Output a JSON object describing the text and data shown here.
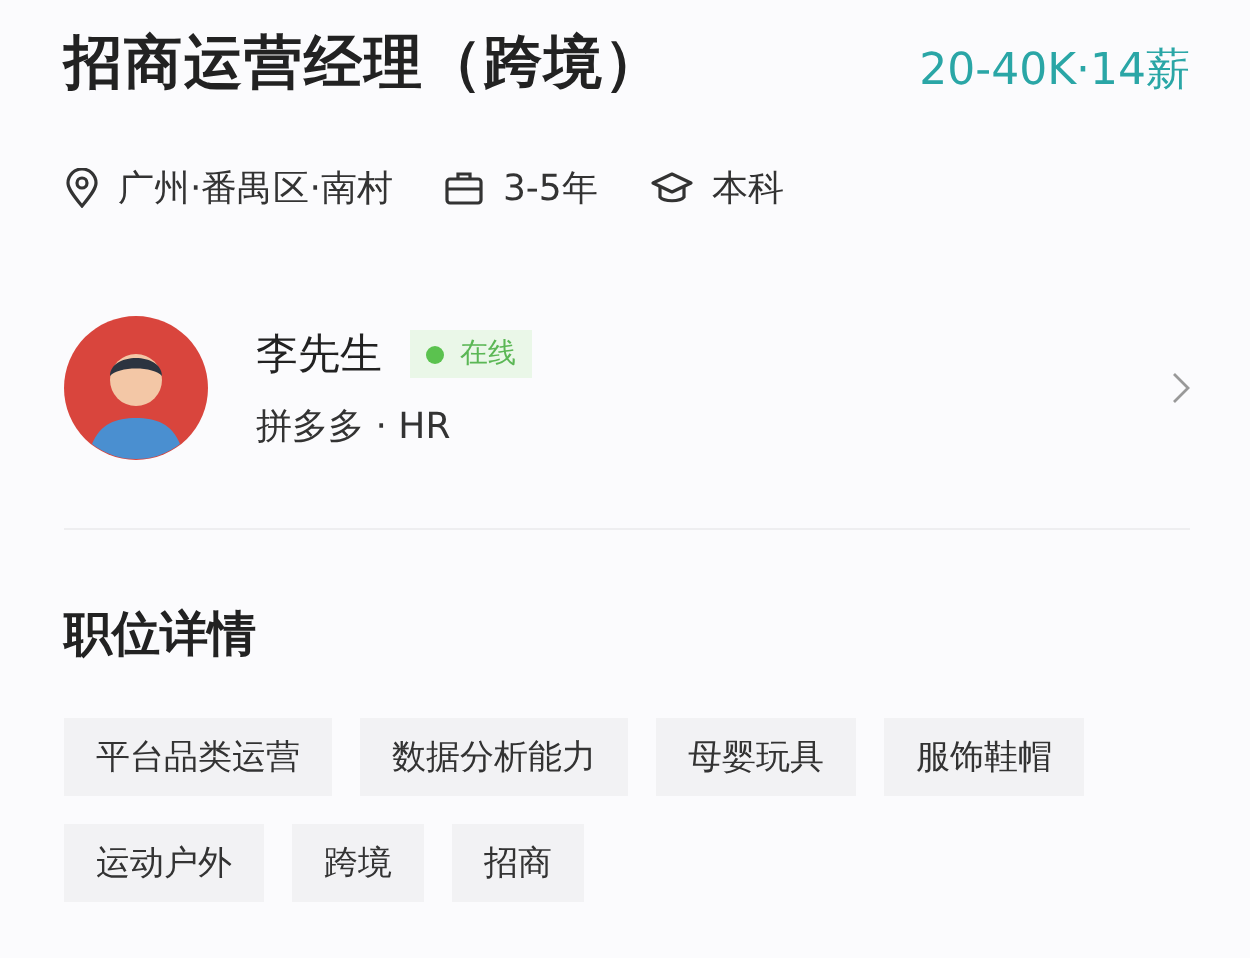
{
  "job": {
    "title": "招商运营经理（跨境）",
    "salary": "20-40K·14薪"
  },
  "meta": [
    {
      "kind": "location",
      "text": "广州·番禺区·南村"
    },
    {
      "kind": "experience",
      "text": "3-5年"
    },
    {
      "kind": "education",
      "text": "本科"
    }
  ],
  "recruiter": {
    "name": "李先生",
    "online": true,
    "status": "在线",
    "company": "拼多多 · HR"
  },
  "details": {
    "heading": "职位详情",
    "tags": [
      "平台品类运营",
      "数据分析能力",
      "母婴玩具",
      "服饰鞋帽",
      "运动户外",
      "跨境",
      "招商"
    ]
  }
}
